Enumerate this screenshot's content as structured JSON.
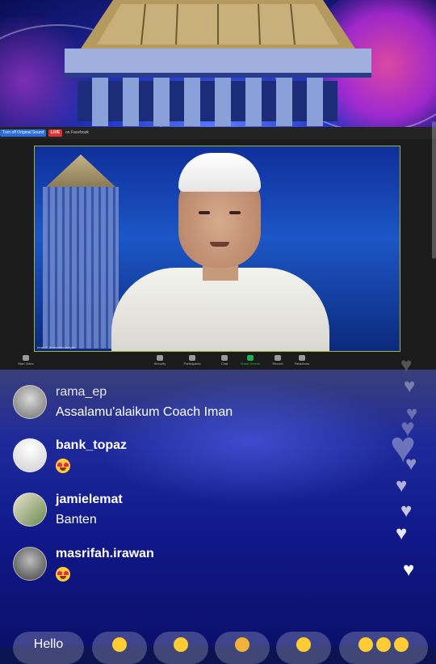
{
  "zoom": {
    "chips": {
      "source": "Turn off Original Sound",
      "live": "LIVE",
      "platform": "on Facebook"
    },
    "speaker_name": "Iman S. Abdurrahmansyah",
    "toolbar": {
      "video": "Start Video",
      "security": "Security",
      "participants": "Participants",
      "chat": "Chat",
      "share": "Share Screen",
      "record": "Record",
      "reactions": "Reactions"
    }
  },
  "comments": [
    {
      "username": "rama_ep",
      "text": "Assalamu'alaikum Coach Iman",
      "emoji": false
    },
    {
      "username": "bank_topaz",
      "text": "",
      "emoji": true,
      "emoji_name": "heart-eyes-emoji"
    },
    {
      "username": "jamielemat",
      "text": "Banten",
      "emoji": false
    },
    {
      "username": "masrifah.irawan",
      "text": "",
      "emoji": true,
      "emoji_name": "heart-eyes-emoji"
    }
  ],
  "reactions_bar": {
    "first_pill": "Hello"
  },
  "colors": {
    "live": "#e03131",
    "accent": "#2d6cdf",
    "share": "#23b14d"
  }
}
